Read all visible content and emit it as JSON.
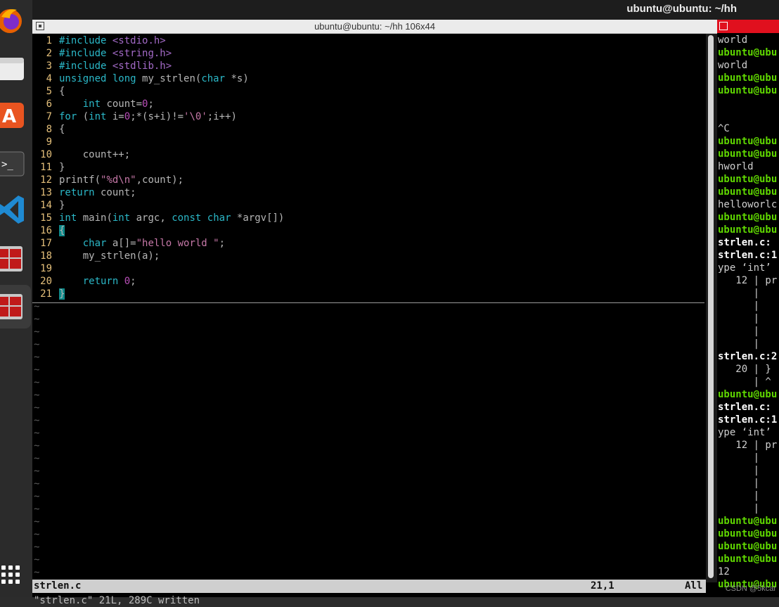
{
  "topbar": {
    "title": "ubuntu@ubuntu: ~/hh"
  },
  "dock": {
    "items": [
      {
        "name": "firefox-icon"
      },
      {
        "name": "files-icon"
      },
      {
        "name": "app-center-icon"
      },
      {
        "name": "terminal-icon"
      },
      {
        "name": "vscode-icon"
      },
      {
        "name": "app-window-icon"
      },
      {
        "name": "app-window-icon"
      },
      {
        "name": "show-apps-icon"
      }
    ]
  },
  "terminal": {
    "title": "ubuntu@ubuntu: ~/hh 106x44",
    "lines": [
      {
        "n": "1",
        "text": "#include <stdio.h>"
      },
      {
        "n": "2",
        "text": "#include <string.h>"
      },
      {
        "n": "3",
        "text": "#include <stdlib.h>"
      },
      {
        "n": "4",
        "text": "unsigned long my_strlen(char *s)"
      },
      {
        "n": "5",
        "text": "{"
      },
      {
        "n": "6",
        "text": "    int count=0;"
      },
      {
        "n": "7",
        "text": "for (int i=0;*(s+i)!='\\0';i++)"
      },
      {
        "n": "8",
        "text": "{"
      },
      {
        "n": "9",
        "text": ""
      },
      {
        "n": "10",
        "text": "    count++;"
      },
      {
        "n": "11",
        "text": "}"
      },
      {
        "n": "12",
        "text": "printf(\"%d\\n\",count);"
      },
      {
        "n": "13",
        "text": "return count;"
      },
      {
        "n": "14",
        "text": "}"
      },
      {
        "n": "15",
        "text": "int main(int argc, const char *argv[])"
      },
      {
        "n": "16",
        "text": "{"
      },
      {
        "n": "17",
        "text": "    char a[]=\"hello world \";"
      },
      {
        "n": "18",
        "text": "    my_strlen(a);"
      },
      {
        "n": "19",
        "text": ""
      },
      {
        "n": "20",
        "text": "    return 0;"
      },
      {
        "n": "21",
        "text": "}"
      }
    ],
    "tilde": "~",
    "status": {
      "file": "strlen.c",
      "position": "21,1",
      "scroll": "All"
    },
    "message": "\"strlen.c\" 21L, 289C written"
  },
  "right_terminal": {
    "lines": [
      {
        "t": "world",
        "s": ""
      },
      {
        "t": "ubuntu@ubu",
        "s": "g"
      },
      {
        "t": "world",
        "s": ""
      },
      {
        "t": "ubuntu@ubu",
        "s": "g"
      },
      {
        "t": "ubuntu@ubu",
        "s": "g"
      },
      {
        "t": "",
        "s": ""
      },
      {
        "t": "",
        "s": ""
      },
      {
        "t": "^C",
        "s": ""
      },
      {
        "t": "ubuntu@ubu",
        "s": "g"
      },
      {
        "t": "ubuntu@ubu",
        "s": "g"
      },
      {
        "t": "hworld",
        "s": ""
      },
      {
        "t": "ubuntu@ubu",
        "s": "g"
      },
      {
        "t": "ubuntu@ubu",
        "s": "g"
      },
      {
        "t": "helloworlc",
        "s": ""
      },
      {
        "t": "ubuntu@ubu",
        "s": "g"
      },
      {
        "t": "ubuntu@ubu",
        "s": "g"
      },
      {
        "t": "strlen.c:",
        "s": "b"
      },
      {
        "t": "strlen.c:1",
        "s": "b"
      },
      {
        "t": "ype ‘int’",
        "s": ""
      },
      {
        "t": "   12 | pr",
        "s": ""
      },
      {
        "t": "      |",
        "s": ""
      },
      {
        "t": "      |",
        "s": ""
      },
      {
        "t": "      |",
        "s": ""
      },
      {
        "t": "      |",
        "s": ""
      },
      {
        "t": "      |",
        "s": ""
      },
      {
        "t": "strlen.c:2",
        "s": "b"
      },
      {
        "t": "   20 | }",
        "s": ""
      },
      {
        "t": "      | ^",
        "s": ""
      },
      {
        "t": "ubuntu@ubu",
        "s": "g"
      },
      {
        "t": "strlen.c:",
        "s": "b"
      },
      {
        "t": "strlen.c:1",
        "s": "b"
      },
      {
        "t": "ype ‘int’",
        "s": ""
      },
      {
        "t": "   12 | pr",
        "s": ""
      },
      {
        "t": "      |",
        "s": ""
      },
      {
        "t": "      |",
        "s": ""
      },
      {
        "t": "      |",
        "s": ""
      },
      {
        "t": "      |",
        "s": ""
      },
      {
        "t": "      |",
        "s": ""
      },
      {
        "t": "ubuntu@ubu",
        "s": "g"
      },
      {
        "t": "ubuntu@ubu",
        "s": "g"
      },
      {
        "t": "ubuntu@ubu",
        "s": "g"
      },
      {
        "t": "ubuntu@ubu",
        "s": "g"
      },
      {
        "t": "12",
        "s": ""
      },
      {
        "t": "ubuntu@ubu",
        "s": "g"
      }
    ],
    "watermark": "CSDN @5kcar"
  },
  "colors": {
    "line_number": "#e5c07b",
    "keyword": "#2bb8c8",
    "preprocessor": "#a36ac7",
    "string": "#c678a8",
    "prompt_green": "#5fd700",
    "error_red": "#e01010",
    "right_titlebar": "#e0101e"
  }
}
